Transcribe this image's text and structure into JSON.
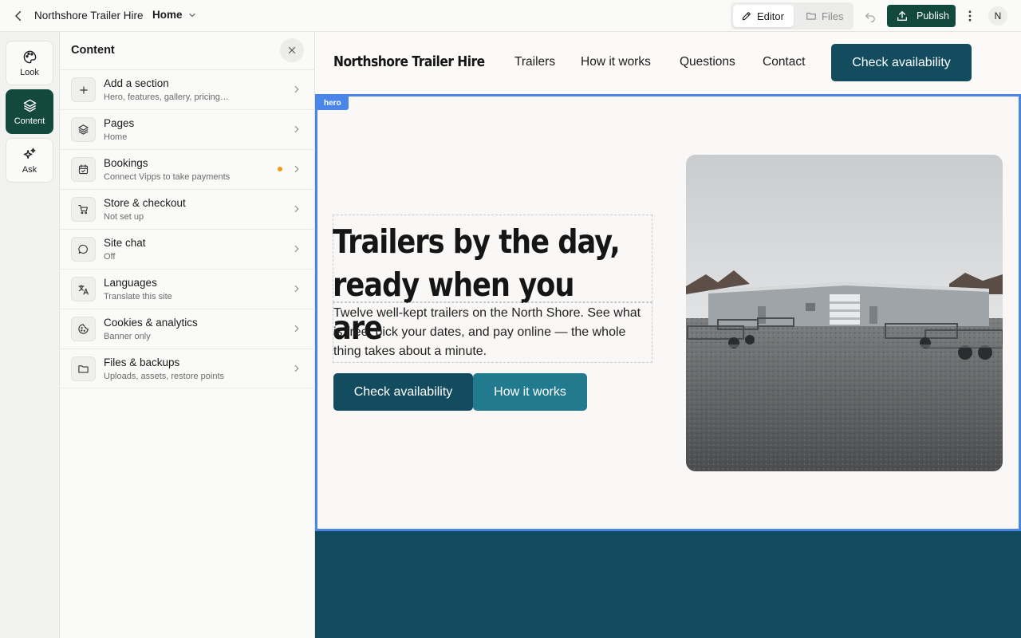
{
  "topbar": {
    "site_name": "Northshore Trailer Hire",
    "page_selector": "Home",
    "tabs": {
      "editor": "Editor",
      "files": "Files"
    },
    "publish_label": "Publish",
    "avatar_initial": "N"
  },
  "rail": {
    "items": [
      {
        "label": "Look",
        "icon": "palette-icon"
      },
      {
        "label": "Content",
        "icon": "layers-icon",
        "active": true
      },
      {
        "label": "Ask",
        "icon": "sparkles-icon"
      }
    ]
  },
  "panel": {
    "title": "Content",
    "items": [
      {
        "label": "Add a section",
        "sub": "Hero, features, gallery, pricing…",
        "icon": "plus-icon"
      },
      {
        "label": "Pages",
        "sub": "Home",
        "icon": "layers-icon"
      },
      {
        "label": "Bookings",
        "sub": "Connect Vipps to take payments",
        "icon": "calendar-check-icon",
        "notice": true
      },
      {
        "label": "Store & checkout",
        "sub": "Not set up",
        "icon": "cart-icon"
      },
      {
        "label": "Site chat",
        "sub": "Off",
        "icon": "chat-bubble-icon"
      },
      {
        "label": "Languages",
        "sub": "Translate this site",
        "icon": "translate-icon"
      },
      {
        "label": "Cookies & analytics",
        "sub": "Banner only",
        "icon": "cookie-icon"
      },
      {
        "label": "Files & backups",
        "sub": "Uploads, assets, restore points",
        "icon": "folder-icon"
      }
    ]
  },
  "site": {
    "brand": "Northshore Trailer Hire",
    "nav": [
      "Trailers",
      "How it works",
      "Questions",
      "Contact"
    ],
    "nav_cta": "Check availability",
    "hero": {
      "section_tag": "hero",
      "heading_line1": "Trailers by the day,",
      "heading_line2": "ready when you are",
      "paragraph": "Twelve well-kept trailers on the North Shore. See what is free, pick your dates, and pay online — the whole thing takes about a minute.",
      "primary_button": "Check availability",
      "secondary_button": "How it works"
    }
  },
  "colors": {
    "accent_dark_green": "#13483f",
    "brand_teal": "#134c5f",
    "secondary_teal": "#217a8e",
    "selection_blue": "#4a86e8",
    "notice_orange": "#f29a1f"
  }
}
